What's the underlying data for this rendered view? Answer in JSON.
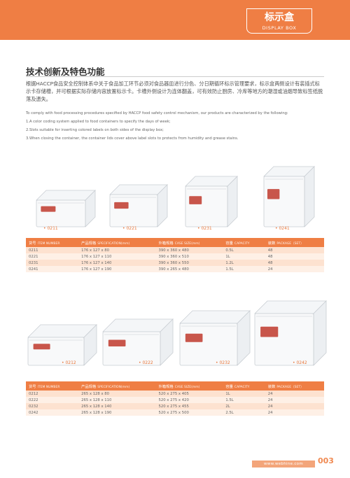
{
  "badge": {
    "title_cn": "标示盒",
    "title_en": "DISPLAY BOX"
  },
  "section": {
    "heading": "技术创新及特色功能",
    "intro_cn": "根据HACCP食品安全控制体系中关于食品加工环节必须对食品器皿进行分色、分日期循环标示管理要求，标示盒两侧设计有装插式标示卡存储槽，并可根据实际存储内容放置标示卡。卡槽外侧设计为连体翻盖，可有效防止厨房、冷库等地方的潮湿或油烟导致标签纸脱落及遗失。",
    "intro_en": [
      "To comply with food processing procedures specified by HACCP food safety control mechanism, our products are characterized by the following:",
      "1.A color coding system applied to food containers to specify the days of week;",
      "2.Slots suitable for inserting colored labels on both sides of the display box;",
      "3.When closing the container, the container lids cover above label slots to protects from humidity and grease stains."
    ]
  },
  "products_row1": [
    {
      "code": "0211",
      "label_color": "#c0392b"
    },
    {
      "code": "0221",
      "label_color": "#c0392b"
    },
    {
      "code": "0231",
      "label_color": "#c0392b"
    },
    {
      "code": "0241",
      "label_color": "#c0392b"
    }
  ],
  "products_row2": [
    {
      "code": "0212",
      "label_color": "#c0392b"
    },
    {
      "code": "0222",
      "label_color": "#c0392b"
    },
    {
      "code": "0232",
      "label_color": "#c0392b"
    },
    {
      "code": "0242",
      "label_color": "#c0392b"
    }
  ],
  "table_headers": [
    {
      "cn": "货号",
      "en": "ITEM NUMBER"
    },
    {
      "cn": "产品规格",
      "en": "SPECIFICATION(mm)"
    },
    {
      "cn": "外箱规格",
      "en": "CASE SIZE(mm)"
    },
    {
      "cn": "容量",
      "en": "CAPACITY"
    },
    {
      "cn": "装数",
      "en": "PACKAGE（SET）"
    }
  ],
  "table1": [
    [
      "0211",
      "176 x 127 x 80",
      "390 x 360 x 480",
      "0.5L",
      "48"
    ],
    [
      "0221",
      "176 x 127 x 110",
      "390 x 360 x 510",
      "1L",
      "48"
    ],
    [
      "0231",
      "176 x 127 x 140",
      "390 x 360 x 550",
      "1.2L",
      "48"
    ],
    [
      "0241",
      "176 x 127 x 190",
      "390 x 265 x 480",
      "1.5L",
      "24"
    ]
  ],
  "table2": [
    [
      "0212",
      "265 x 128 x 80",
      "520 x 275 x 405",
      "1L",
      "24"
    ],
    [
      "0222",
      "265 x 128 x 110",
      "520 x 275 x 420",
      "1.5L",
      "24"
    ],
    [
      "0232",
      "265 x 128 x 140",
      "520 x 275 x 455",
      "2L",
      "24"
    ],
    [
      "0242",
      "265 x 128 x 190",
      "520 x 275 x 500",
      "2.5L",
      "24"
    ]
  ],
  "footer": {
    "url": "www.webhine.com",
    "page": "003"
  },
  "colors": {
    "accent": "#ef7e44",
    "row_odd": "#fde2d0",
    "row_even": "#fef0e6"
  }
}
